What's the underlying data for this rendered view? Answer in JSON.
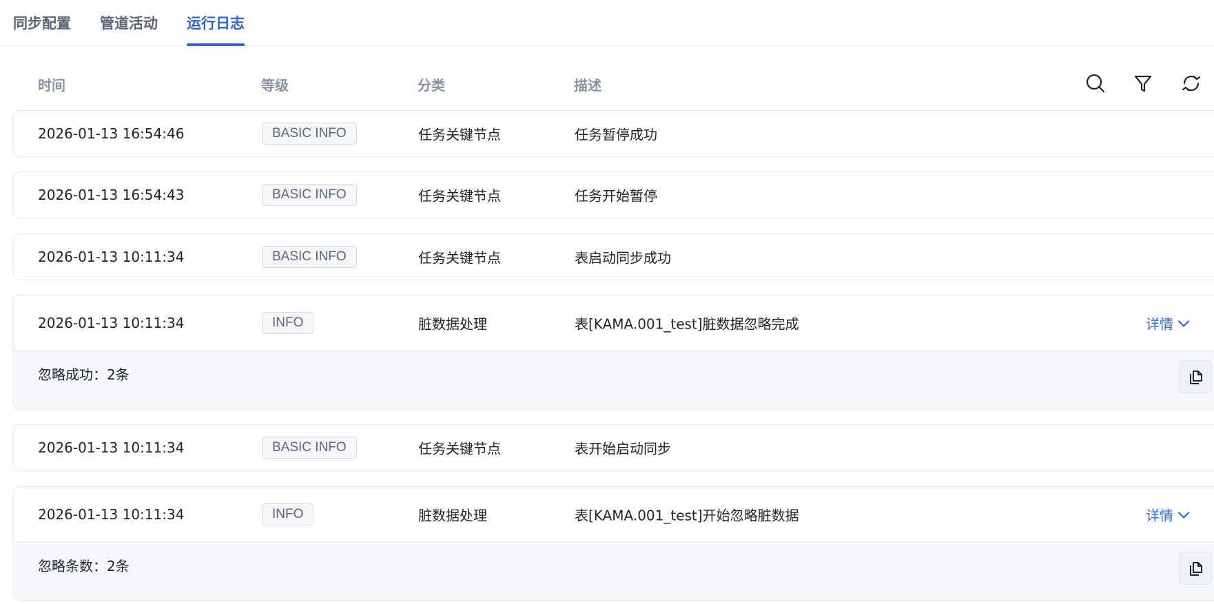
{
  "tabs": [
    {
      "label": "同步配置",
      "active": false
    },
    {
      "label": "管道活动",
      "active": false
    },
    {
      "label": "运行日志",
      "active": true
    }
  ],
  "colors": {
    "accent": "#2f62d3",
    "header_text": "#8a93a3",
    "badge_bg": "#f4f6f9",
    "detail_bg": "#f7f8fb"
  },
  "table": {
    "headers": {
      "time": "时间",
      "level": "等级",
      "category": "分类",
      "description": "描述"
    },
    "toolbar_icons": [
      "search-icon",
      "filter-icon",
      "refresh-icon"
    ],
    "rows": [
      {
        "time": "2026-01-13 16:54:46",
        "level": "BASIC INFO",
        "category": "任务关键节点",
        "description": "任务暂停成功"
      },
      {
        "time": "2026-01-13 16:54:43",
        "level": "BASIC INFO",
        "category": "任务关键节点",
        "description": "任务开始暂停"
      },
      {
        "time": "2026-01-13 10:11:34",
        "level": "BASIC INFO",
        "category": "任务关键节点",
        "description": "表启动同步成功"
      },
      {
        "time": "2026-01-13 10:11:34",
        "level": "INFO",
        "category": "脏数据处理",
        "description": "表[KAMA.001_test]脏数据忽略完成",
        "details_label": "详情",
        "detail_text": "忽略成功：2条"
      },
      {
        "time": "2026-01-13 10:11:34",
        "level": "BASIC INFO",
        "category": "任务关键节点",
        "description": "表开始启动同步"
      },
      {
        "time": "2026-01-13 10:11:34",
        "level": "INFO",
        "category": "脏数据处理",
        "description": "表[KAMA.001_test]开始忽略脏数据",
        "details_label": "详情",
        "detail_text": "忽略条数：2条"
      }
    ]
  }
}
